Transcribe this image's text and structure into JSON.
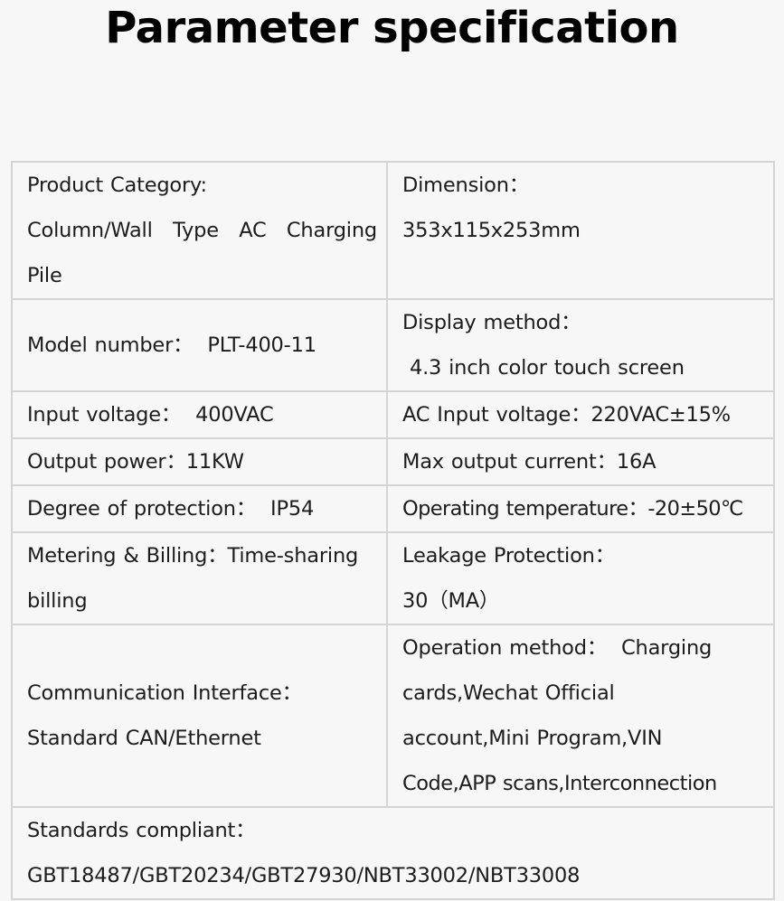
{
  "title": "Parameter specification",
  "rows": [
    {
      "left": [
        "Product Category:",
        "Column/Wall  Type  AC  Charging",
        "Pile"
      ],
      "right": [
        "Dimension：",
        "353x115x253mm"
      ]
    },
    {
      "left": [
        "Model number：  PLT-400-11"
      ],
      "right": [
        "Display method：",
        " 4.3 inch color touch screen"
      ]
    },
    {
      "left": [
        "Input voltage：  400VAC"
      ],
      "right": [
        "AC Input voltage：220VAC±15%"
      ]
    },
    {
      "left": [
        "Output power：11KW"
      ],
      "right": [
        "Max output current：16A"
      ]
    },
    {
      "left": [
        "Degree of protection：  IP54"
      ],
      "right": [
        "Operating temperature：-20±50℃"
      ]
    },
    {
      "left": [
        "Metering & Billing：Time-sharing",
        "billing"
      ],
      "right": [
        "Leakage Protection：",
        "30（MA）"
      ]
    },
    {
      "left": [
        "Communication Interface：",
        "Standard CAN/Ethernet"
      ],
      "right": [
        "Operation method：  Charging",
        "cards,Wechat Official",
        "account,Mini Program,VIN",
        "Code,APP scans,Interconnection"
      ]
    }
  ],
  "footer": [
    "Standards compliant：",
    "GBT18487/GBT20234/GBT27930/NBT33002/NBT33008"
  ]
}
